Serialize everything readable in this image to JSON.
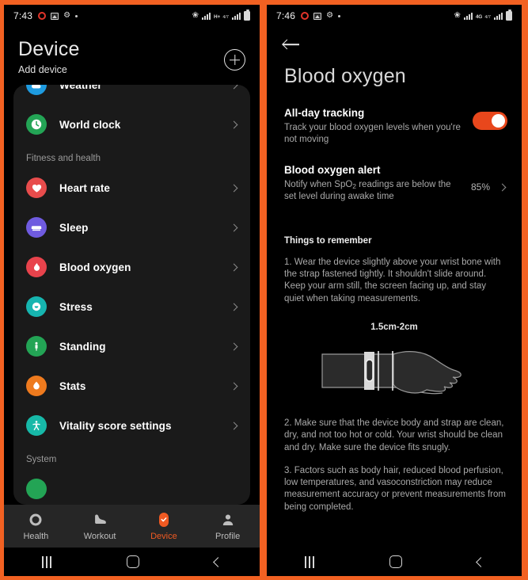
{
  "accent_color": "#F26122",
  "left": {
    "statusbar": {
      "time": "7:43",
      "icons": [
        "record-icon",
        "image-icon",
        "download-icon",
        "dot-icon"
      ],
      "right_icons": [
        "bluetooth-icon",
        "signal-icon",
        "network-type-icon",
        "signal-icon",
        "battery-icon"
      ],
      "network_type": "H+",
      "network_sub": "4/7"
    },
    "header": {
      "title": "Device",
      "subtitle": "Add device",
      "add_button": "add-device-button"
    },
    "list": [
      {
        "label": "Weather",
        "icon": "weather-icon",
        "color": "#1E9BE0",
        "partial": true
      },
      {
        "label": "World clock",
        "icon": "clock-icon",
        "color": "#23A455"
      },
      {
        "section": "Fitness and health"
      },
      {
        "label": "Heart rate",
        "icon": "heart-icon",
        "color": "#E84C4C"
      },
      {
        "label": "Sleep",
        "icon": "bed-icon",
        "color": "#6F5BE0"
      },
      {
        "label": "Blood oxygen",
        "icon": "droplet-icon",
        "color": "#E8434C"
      },
      {
        "label": "Stress",
        "icon": "stress-icon",
        "color": "#16B5B0"
      },
      {
        "label": "Standing",
        "icon": "person-icon",
        "color": "#23A455"
      },
      {
        "label": "Stats",
        "icon": "flame-icon",
        "color": "#EE7A1E"
      },
      {
        "label": "Vitality score settings",
        "icon": "vitality-icon",
        "color": "#17B9A8"
      },
      {
        "section": "System"
      }
    ],
    "bottomnav": [
      {
        "label": "Health",
        "icon": "health-ring-icon",
        "active": false
      },
      {
        "label": "Workout",
        "icon": "shoe-icon",
        "active": false
      },
      {
        "label": "Device",
        "icon": "device-icon",
        "active": true
      },
      {
        "label": "Profile",
        "icon": "person-icon",
        "active": false
      }
    ],
    "sysnav": [
      "recents-button",
      "home-button",
      "back-button"
    ]
  },
  "right": {
    "statusbar": {
      "time": "7:46",
      "network_type": "4G",
      "network_sub": "4/7"
    },
    "back_button": "back-arrow-icon",
    "title": "Blood oxygen",
    "all_day": {
      "title": "All-day tracking",
      "desc": "Track your blood oxygen levels when you're not moving",
      "toggle_on": true
    },
    "alert": {
      "title": "Blood oxygen alert",
      "desc_pre": "Notify when SpO",
      "desc_sub": "2",
      "desc_post": " readings are below the set level during awake time",
      "value": "85%"
    },
    "things": {
      "title": "Things to remember",
      "item1": "1. Wear the device slightly above your wrist bone with the strap fastened tightly. It shouldn't slide around. Keep your arm still, the screen facing up, and stay quiet when taking measurements.",
      "item2": "2. Make sure that the device body and strap are clean, dry, and not too hot or cold. Your wrist should be clean and dry. Make sure the device fits snugly.",
      "item3": "3. Factors such as body hair, reduced blood perfusion, low temperatures, and vasoconstriction may reduce measurement accuracy or prevent measurements from being completed."
    },
    "illustration": {
      "label": "1.5cm-2cm",
      "name": "wrist-watch-placement-illustration"
    },
    "sysnav": [
      "recents-button",
      "home-button",
      "back-button"
    ]
  }
}
